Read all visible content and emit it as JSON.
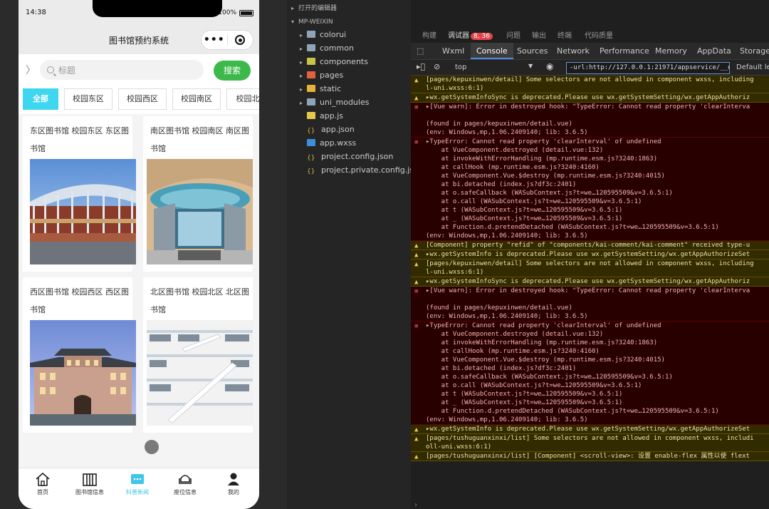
{
  "phone": {
    "status_time": "14:38",
    "battery": "100%",
    "title": "图书馆预约系统",
    "capsule_dots": "•••",
    "search_placeholder": "标题",
    "search_button": "搜索",
    "categories": [
      "全部",
      "校园东区",
      "校园西区",
      "校园南区",
      "校园北"
    ],
    "cards": [
      {
        "title": "东区图书馆 校园东区 东区图书馆"
      },
      {
        "title": "南区图书馆 校园南区 南区图书馆"
      },
      {
        "title": "西区图书馆 校园西区 西区图书馆"
      },
      {
        "title": "北区图书馆 校园北区 北区图书馆"
      }
    ],
    "tabs": [
      {
        "label": "首页",
        "icon": "home-icon"
      },
      {
        "label": "图书馆信息",
        "icon": "books-icon"
      },
      {
        "label": "科普新闻",
        "icon": "news-icon"
      },
      {
        "label": "座位信息",
        "icon": "seat-icon"
      },
      {
        "label": "我的",
        "icon": "user-icon"
      }
    ],
    "accent": "#3fd6f0",
    "button_green": "#3cb94a"
  },
  "tree": {
    "open_editors": "打开的编辑器",
    "project": "MP-WEIXIN",
    "items": [
      {
        "name": "colorui",
        "type": "folder"
      },
      {
        "name": "common",
        "type": "folder"
      },
      {
        "name": "components",
        "type": "folder"
      },
      {
        "name": "pages",
        "type": "folder"
      },
      {
        "name": "static",
        "type": "folder"
      },
      {
        "name": "uni_modules",
        "type": "folder"
      },
      {
        "name": "app.js",
        "type": "js"
      },
      {
        "name": "app.json",
        "type": "json"
      },
      {
        "name": "app.wxss",
        "type": "css"
      },
      {
        "name": "project.config.json",
        "type": "json"
      },
      {
        "name": "project.private.config.js...",
        "type": "json"
      }
    ]
  },
  "devtools": {
    "top_tabs": [
      "构建",
      "调试器",
      "问题",
      "输出",
      "终端",
      "代码质量"
    ],
    "badges": [
      "8",
      "36"
    ],
    "panel_tabs": [
      "Wxml",
      "Console",
      "Sources",
      "Network",
      "Performance",
      "Memory",
      "AppData",
      "Storage"
    ],
    "context": "top",
    "url_filter": "-url:http://127.0.0.1:21971/appservice/__dev__/",
    "default_levels": "Default lev",
    "messages": [
      {
        "level": "warn",
        "text": "[pages/kepuxinwen/detail] Some selectors are not allowed in component wxss, including\nl-uni.wxss:6:1)"
      },
      {
        "level": "warn",
        "text": "▸wx.getSystemInfoSync is deprecated.Please use wx.getSystemSetting/wx.getAppAuthoriz"
      },
      {
        "level": "error",
        "text": "▸[Vue warn]: Error in destroyed hook: \"TypeError: Cannot read property 'clearInterva\n\n(found in pages/kepuxinwen/detail.vue)\n(env: Windows,mp,1.06.2409140; lib: 3.6.5)"
      },
      {
        "level": "error",
        "text": "▸TypeError: Cannot read property 'clearInterval' of undefined\n    at VueComponent.destroyed (detail.vue:132)\n    at invokeWithErrorHandling (mp.runtime.esm.js?3240:1863)\n    at callHook (mp.runtime.esm.js?3240:4160)\n    at VueComponent.Vue.$destroy (mp.runtime.esm.js?3240:4015)\n    at bi.detached (index.js?df3c:2401)\n    at o.safeCallback (WASubContext.js?t=we…120595509&v=3.6.5:1)\n    at o.call (WASubContext.js?t=we…120595509&v=3.6.5:1)\n    at t (WASubContext.js?t=we…120595509&v=3.6.5:1)\n    at _ (WASubContext.js?t=we…120595509&v=3.6.5:1)\n    at Function.d.pretendDetached (WASubContext.js?t=we…120595509&v=3.6.5:1)\n(env: Windows,mp,1.06.2409140; lib: 3.6.5)"
      },
      {
        "level": "warn",
        "text": "[Component] property \"refid\" of \"components/kai-comment/kai-comment\" received type-u"
      },
      {
        "level": "warn",
        "text": "▸wx.getSystemInfo is deprecated.Please use wx.getSystemSetting/wx.getAppAuthorizeSet"
      },
      {
        "level": "warn",
        "text": "[pages/kepuxinwen/detail] Some selectors are not allowed in component wxss, including\nl-uni.wxss:6:1)"
      },
      {
        "level": "warn",
        "text": "▸wx.getSystemInfoSync is deprecated.Please use wx.getSystemSetting/wx.getAppAuthoriz"
      },
      {
        "level": "error",
        "text": "▸[Vue warn]: Error in destroyed hook: \"TypeError: Cannot read property 'clearInterva\n\n(found in pages/kepuxinwen/detail.vue)\n(env: Windows,mp,1.06.2409140; lib: 3.6.5)"
      },
      {
        "level": "error",
        "text": "▸TypeError: Cannot read property 'clearInterval' of undefined\n    at VueComponent.destroyed (detail.vue:132)\n    at invokeWithErrorHandling (mp.runtime.esm.js?3240:1863)\n    at callHook (mp.runtime.esm.js?3240:4160)\n    at VueComponent.Vue.$destroy (mp.runtime.esm.js?3240:4015)\n    at bi.detached (index.js?df3c:2401)\n    at o.safeCallback (WASubContext.js?t=we…120595509&v=3.6.5:1)\n    at o.call (WASubContext.js?t=we…120595509&v=3.6.5:1)\n    at t (WASubContext.js?t=we…120595509&v=3.6.5:1)\n    at _ (WASubContext.js?t=we…120595509&v=3.6.5:1)\n    at Function.d.pretendDetached (WASubContext.js?t=we…120595509&v=3.6.5:1)\n(env: Windows,mp,1.06.2409140; lib: 3.6.5)"
      },
      {
        "level": "warn",
        "text": "▸wx.getSystemInfo is deprecated.Please use wx.getSystemSetting/wx.getAppAuthorizeSet"
      },
      {
        "level": "warn",
        "text": "[pages/tushuguanxinxi/list] Some selectors are not allowed in component wxss, includi\noll-uni.wxss:6:1)"
      },
      {
        "level": "warn",
        "text": "[pages/tushuguanxinxi/list] [Component] <scroll-view>: 设置 enable-flex 属性以使 flext"
      }
    ]
  }
}
